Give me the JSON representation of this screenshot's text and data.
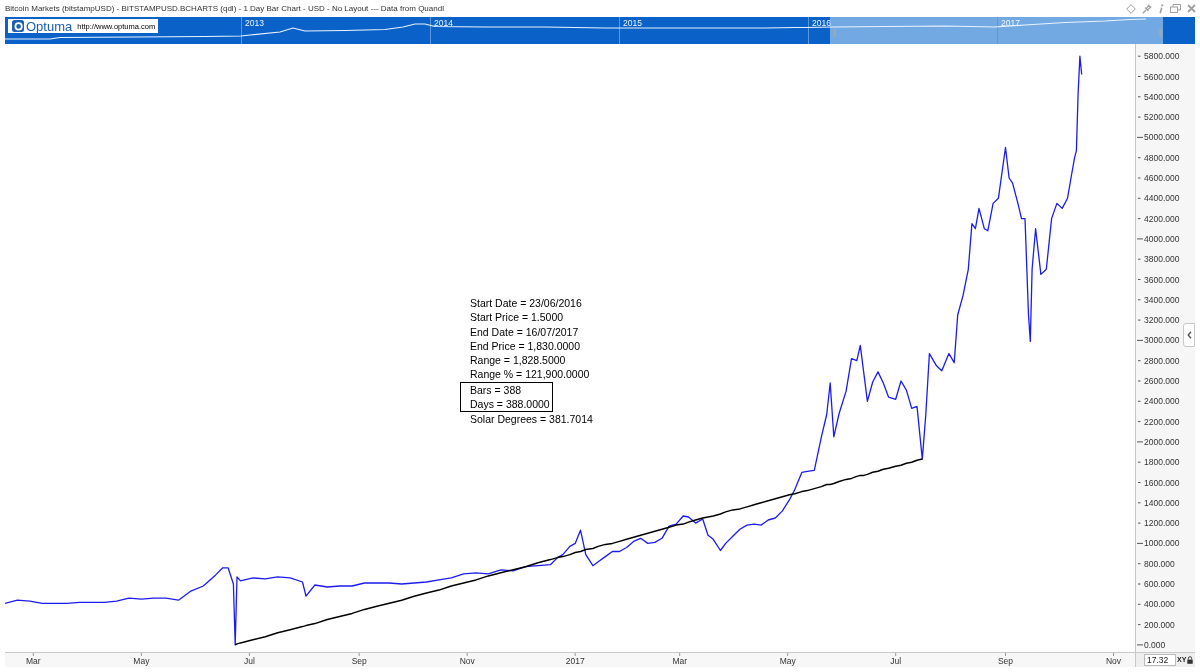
{
  "window": {
    "title": "Bitcoin Markets (bitstampUSD) - BITSTAMPUSD.BCHARTS (qdl) - 1 Day Bar Chart - USD - No Layout --- Data from Quandl"
  },
  "navigator": {
    "logo": {
      "name": "Optuma",
      "url": "http://www.optuma.com"
    },
    "years": [
      "2013",
      "2014",
      "2015",
      "2016",
      "2017"
    ]
  },
  "chart": {
    "chart_data": {
      "type": "line",
      "x": [
        "2016-02-14",
        "2016-02-21",
        "2016-02-28",
        "2016-03-06",
        "2016-03-13",
        "2016-03-20",
        "2016-03-27",
        "2016-04-03",
        "2016-04-10",
        "2016-04-17",
        "2016-04-24",
        "2016-05-01",
        "2016-05-08",
        "2016-05-15",
        "2016-05-22",
        "2016-05-29",
        "2016-06-05",
        "2016-06-12",
        "2016-06-16",
        "2016-06-19",
        "2016-06-22",
        "2016-06-23",
        "2016-06-24",
        "2016-06-26",
        "2016-07-03",
        "2016-07-10",
        "2016-07-17",
        "2016-07-24",
        "2016-07-31",
        "2016-08-02",
        "2016-08-07",
        "2016-08-14",
        "2016-08-21",
        "2016-08-28",
        "2016-09-04",
        "2016-09-11",
        "2016-09-18",
        "2016-09-25",
        "2016-10-02",
        "2016-10-09",
        "2016-10-16",
        "2016-10-23",
        "2016-10-30",
        "2016-11-06",
        "2016-11-13",
        "2016-11-20",
        "2016-11-27",
        "2016-12-04",
        "2016-12-11",
        "2016-12-18",
        "2016-12-22",
        "2016-12-25",
        "2016-12-29",
        "2017-01-01",
        "2017-01-04",
        "2017-01-07",
        "2017-01-11",
        "2017-01-14",
        "2017-01-18",
        "2017-01-22",
        "2017-01-26",
        "2017-01-30",
        "2017-02-03",
        "2017-02-07",
        "2017-02-11",
        "2017-02-15",
        "2017-02-19",
        "2017-02-23",
        "2017-02-27",
        "2017-03-03",
        "2017-03-06",
        "2017-03-10",
        "2017-03-14",
        "2017-03-17",
        "2017-03-20",
        "2017-03-24",
        "2017-03-27",
        "2017-03-31",
        "2017-04-04",
        "2017-04-08",
        "2017-04-12",
        "2017-04-16",
        "2017-04-20",
        "2017-04-24",
        "2017-04-28",
        "2017-05-02",
        "2017-05-05",
        "2017-05-09",
        "2017-05-12",
        "2017-05-16",
        "2017-05-20",
        "2017-05-23",
        "2017-05-25",
        "2017-05-27",
        "2017-05-30",
        "2017-06-03",
        "2017-06-06",
        "2017-06-09",
        "2017-06-11",
        "2017-06-13",
        "2017-06-15",
        "2017-06-18",
        "2017-06-21",
        "2017-06-24",
        "2017-06-27",
        "2017-07-01",
        "2017-07-04",
        "2017-07-07",
        "2017-07-10",
        "2017-07-13",
        "2017-07-16",
        "2017-07-18",
        "2017-07-20",
        "2017-07-24",
        "2017-07-27",
        "2017-07-31",
        "2017-08-03",
        "2017-08-05",
        "2017-08-08",
        "2017-08-11",
        "2017-08-13",
        "2017-08-15",
        "2017-08-17",
        "2017-08-20",
        "2017-08-22",
        "2017-08-25",
        "2017-08-28",
        "2017-09-01",
        "2017-09-03",
        "2017-09-05",
        "2017-09-08",
        "2017-09-10",
        "2017-09-12",
        "2017-09-14",
        "2017-09-15",
        "2017-09-16",
        "2017-09-18",
        "2017-09-21",
        "2017-09-24",
        "2017-09-27",
        "2017-09-30",
        "2017-10-03",
        "2017-10-06",
        "2017-10-08",
        "2017-10-10",
        "2017-10-11",
        "2017-10-12",
        "2017-10-13",
        "2017-10-14"
      ],
      "series": [
        {
          "color": "#1c1cf0",
          "values": [
            410,
            440,
            430,
            410,
            410,
            410,
            420,
            420,
            420,
            430,
            460,
            450,
            460,
            460,
            440,
            530,
            580,
            690,
            760,
            760,
            600,
            0,
            670,
            630,
            660,
            650,
            670,
            660,
            620,
            480,
            590,
            570,
            580,
            580,
            610,
            610,
            610,
            600,
            610,
            620,
            640,
            660,
            700,
            710,
            700,
            740,
            730,
            770,
            780,
            790,
            860,
            890,
            970,
            1000,
            1130,
            890,
            780,
            820,
            870,
            920,
            920,
            960,
            1020,
            1050,
            1000,
            1010,
            1050,
            1170,
            1190,
            1270,
            1260,
            1200,
            1240,
            1080,
            1040,
            930,
            1000,
            1070,
            1140,
            1180,
            1190,
            1180,
            1230,
            1250,
            1320,
            1430,
            1530,
            1700,
            1710,
            1720,
            2050,
            2270,
            2580,
            2050,
            2280,
            2500,
            2820,
            2800,
            2950,
            2670,
            2400,
            2590,
            2690,
            2580,
            2440,
            2420,
            2600,
            2510,
            2330,
            2350,
            1830,
            2270,
            2870,
            2750,
            2700,
            2870,
            2780,
            3250,
            3440,
            3700,
            4150,
            4100,
            4300,
            4100,
            4080,
            4350,
            4400,
            4900,
            4600,
            4550,
            4350,
            4200,
            4200,
            3250,
            2990,
            3700,
            4100,
            3650,
            3700,
            4200,
            4350,
            4300,
            4400,
            4600,
            4800,
            4870,
            5430,
            5800,
            5620
          ]
        },
        {
          "color": "#000000",
          "values": [
            null,
            null,
            null,
            null,
            null,
            null,
            null,
            null,
            null,
            null,
            null,
            null,
            null,
            null,
            null,
            null,
            null,
            null,
            null,
            null,
            null,
            0,
            10,
            20,
            50,
            80,
            120,
            150,
            180,
            190,
            210,
            250,
            280,
            310,
            350,
            380,
            410,
            440,
            480,
            510,
            540,
            580,
            610,
            640,
            680,
            710,
            740,
            770,
            810,
            840,
            860,
            870,
            890,
            910,
            920,
            940,
            950,
            970,
            990,
            1000,
            1020,
            1040,
            1060,
            1080,
            1100,
            1120,
            1140,
            1160,
            1180,
            1190,
            1210,
            1230,
            1250,
            1260,
            1270,
            1290,
            1310,
            1330,
            1340,
            1360,
            1380,
            1400,
            1420,
            1440,
            1460,
            1480,
            1490,
            1510,
            1520,
            1540,
            1560,
            1580,
            1580,
            1590,
            1610,
            1630,
            1640,
            1660,
            1670,
            1670,
            1680,
            1700,
            1710,
            1730,
            1740,
            1760,
            1770,
            1790,
            1800,
            1820,
            1830,
            null,
            null,
            null,
            null,
            null,
            null,
            null,
            null,
            null,
            null,
            null,
            null,
            null,
            null,
            null,
            null,
            null,
            null,
            null,
            null,
            null,
            null,
            null,
            null,
            null,
            null,
            null,
            null,
            null,
            null,
            null,
            null,
            null,
            null,
            null,
            null,
            null,
            null
          ]
        }
      ],
      "xlim": [
        "2016-02-14",
        "2017-12-17"
      ],
      "ylim": [
        -70,
        5920
      ],
      "xticks": [
        {
          "value": "2016-03-01",
          "label": "Mar"
        },
        {
          "value": "2016-05-01",
          "label": "May"
        },
        {
          "value": "2016-07-01",
          "label": "Jul"
        },
        {
          "value": "2016-09-01",
          "label": "Sep"
        },
        {
          "value": "2016-11-01",
          "label": "Nov"
        },
        {
          "value": "2017-01-01",
          "label": "2017"
        },
        {
          "value": "2017-03-01",
          "label": "Mar"
        },
        {
          "value": "2017-05-01",
          "label": "May"
        },
        {
          "value": "2017-07-01",
          "label": "Jul"
        },
        {
          "value": "2017-09-01",
          "label": "Sep"
        },
        {
          "value": "2017-11-01",
          "label": "Nov"
        }
      ],
      "yticks": [
        {
          "value": 0,
          "label": "0.000"
        },
        {
          "value": 200,
          "label": "200.000"
        },
        {
          "value": 400,
          "label": "400.000"
        },
        {
          "value": 600,
          "label": "600.000"
        },
        {
          "value": 800,
          "label": "800.000"
        },
        {
          "value": 1000,
          "label": "1000.000"
        },
        {
          "value": 1200,
          "label": "1200.000"
        },
        {
          "value": 1400,
          "label": "1400.000"
        },
        {
          "value": 1600,
          "label": "1600.000"
        },
        {
          "value": 1800,
          "label": "1800.000"
        },
        {
          "value": 2000,
          "label": "2000.000"
        },
        {
          "value": 2200,
          "label": "2200.000"
        },
        {
          "value": 2400,
          "label": "2400.000"
        },
        {
          "value": 2600,
          "label": "2600.000"
        },
        {
          "value": 2800,
          "label": "2800.000"
        },
        {
          "value": 3000,
          "label": "3000.000"
        },
        {
          "value": 3200,
          "label": "3200.000"
        },
        {
          "value": 3400,
          "label": "3400.000"
        },
        {
          "value": 3600,
          "label": "3600.000"
        },
        {
          "value": 3800,
          "label": "3800.000"
        },
        {
          "value": 4000,
          "label": "4000.000"
        },
        {
          "value": 4200,
          "label": "4200.000"
        },
        {
          "value": 4400,
          "label": "4400.000"
        },
        {
          "value": 4600,
          "label": "4600.000"
        },
        {
          "value": 4800,
          "label": "4800.000"
        },
        {
          "value": 5000,
          "label": "5000.000"
        },
        {
          "value": 5200,
          "label": "5200.000"
        },
        {
          "value": 5400,
          "label": "5400.000"
        },
        {
          "value": 5600,
          "label": "5600.000"
        },
        {
          "value": 5800,
          "label": "5800.000"
        }
      ]
    }
  },
  "measurement": {
    "lines": [
      {
        "text": "Start Date = 23/06/2016",
        "boxed": false
      },
      {
        "text": "Start Price = 1.5000",
        "boxed": false
      },
      {
        "text": "End Date = 16/07/2017",
        "boxed": false
      },
      {
        "text": "End Price = 1,830.0000",
        "boxed": false
      },
      {
        "text": "Range = 1,828.5000",
        "boxed": false
      },
      {
        "text": "Range % = 121,900.0000",
        "boxed": false
      },
      {
        "text": "Bars = 388",
        "boxed": true
      },
      {
        "text": "Days = 388.0000",
        "boxed": true
      },
      {
        "text": "Solar Degrees = 381.7014",
        "boxed": false
      }
    ]
  },
  "readout": {
    "value": "17.32",
    "mode": "XY"
  }
}
